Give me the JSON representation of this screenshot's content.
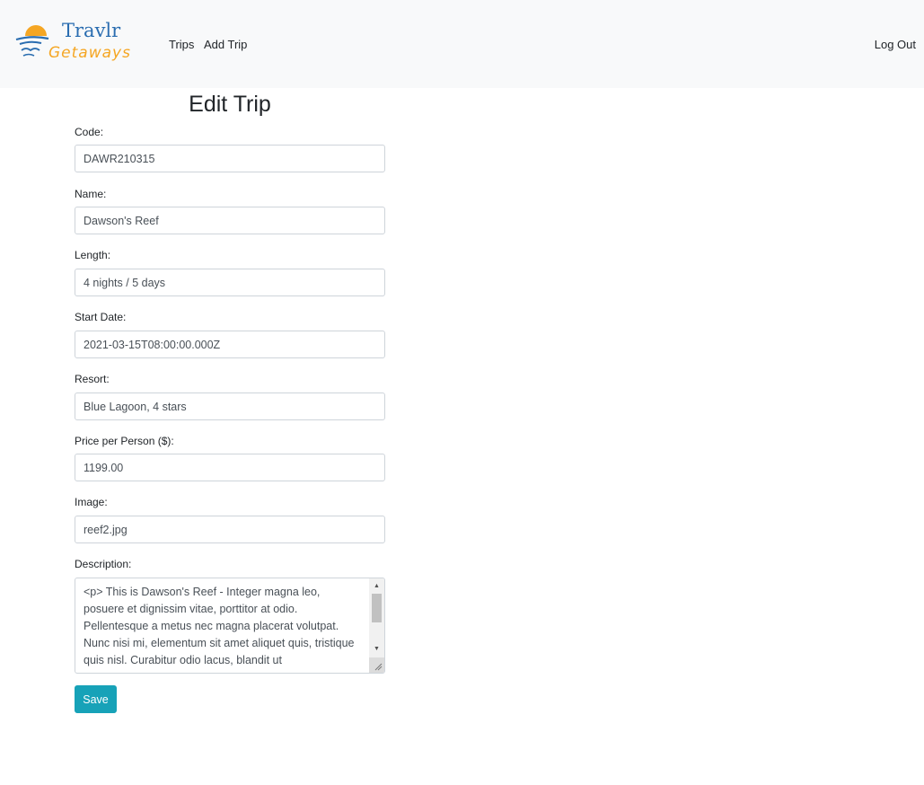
{
  "brand": {
    "logo_text_top": "Travlr",
    "logo_text_bottom": "Getaways",
    "colors": {
      "blue": "#2a6db0",
      "orange": "#f5a623"
    }
  },
  "nav": {
    "items": [
      {
        "label": "Trips"
      },
      {
        "label": "Add Trip"
      }
    ],
    "logout_label": "Log Out"
  },
  "page": {
    "title": "Edit Trip"
  },
  "form": {
    "code": {
      "label": "Code:",
      "value": "DAWR210315"
    },
    "name": {
      "label": "Name:",
      "value": "Dawson's Reef"
    },
    "length": {
      "label": "Length:",
      "value": "4 nights / 5 days"
    },
    "start": {
      "label": "Start Date:",
      "value": "2021-03-15T08:00:00.000Z"
    },
    "resort": {
      "label": "Resort:",
      "value": "Blue Lagoon, 4 stars"
    },
    "perPerson": {
      "label": "Price per Person ($):",
      "value": "1199.00"
    },
    "image": {
      "label": "Image:",
      "value": "reef2.jpg"
    },
    "description": {
      "label": "Description:",
      "value": "<p> This is Dawson's Reef - Integer magna leo, posuere et dignissim vitae, porttitor at odio. Pellentesque a metus nec magna placerat volutpat. Nunc nisi mi, elementum sit amet aliquet quis, tristique quis nisl. Curabitur odio lacus, blandit ut"
    },
    "save_label": "Save",
    "save_color": "#17a2b8"
  }
}
